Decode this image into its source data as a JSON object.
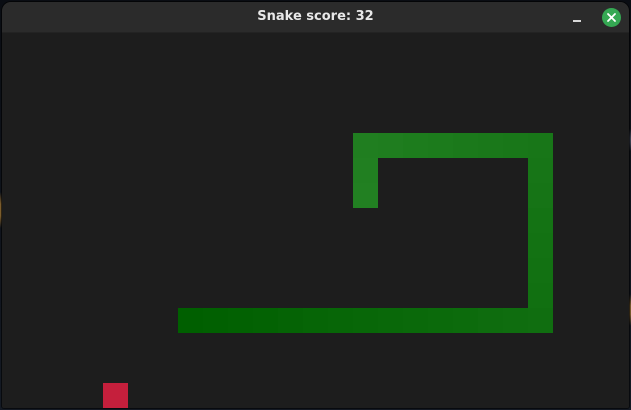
{
  "window": {
    "title": "Snake score: 32",
    "close_icon": "close-icon",
    "minimize_icon": "minimize-icon"
  },
  "game": {
    "score": 32,
    "grid_columns": 25,
    "grid_rows": 15,
    "snake_color_head": "#228022",
    "snake_color_tail": "#005f00",
    "food_color": "#c51f3c",
    "background_color": "#1d1d1d",
    "snake": [
      {
        "col": 14,
        "row": 6
      },
      {
        "col": 14,
        "row": 5
      },
      {
        "col": 14,
        "row": 4
      },
      {
        "col": 15,
        "row": 4
      },
      {
        "col": 16,
        "row": 4
      },
      {
        "col": 17,
        "row": 4
      },
      {
        "col": 18,
        "row": 4
      },
      {
        "col": 19,
        "row": 4
      },
      {
        "col": 20,
        "row": 4
      },
      {
        "col": 21,
        "row": 4
      },
      {
        "col": 21,
        "row": 5
      },
      {
        "col": 21,
        "row": 6
      },
      {
        "col": 21,
        "row": 7
      },
      {
        "col": 21,
        "row": 8
      },
      {
        "col": 21,
        "row": 9
      },
      {
        "col": 21,
        "row": 10
      },
      {
        "col": 21,
        "row": 11
      },
      {
        "col": 20,
        "row": 11
      },
      {
        "col": 19,
        "row": 11
      },
      {
        "col": 18,
        "row": 11
      },
      {
        "col": 17,
        "row": 11
      },
      {
        "col": 16,
        "row": 11
      },
      {
        "col": 15,
        "row": 11
      },
      {
        "col": 14,
        "row": 11
      },
      {
        "col": 13,
        "row": 11
      },
      {
        "col": 12,
        "row": 11
      },
      {
        "col": 11,
        "row": 11
      },
      {
        "col": 10,
        "row": 11
      },
      {
        "col": 9,
        "row": 11
      },
      {
        "col": 8,
        "row": 11
      },
      {
        "col": 7,
        "row": 11
      }
    ],
    "food": {
      "col": 4,
      "row": 14
    }
  }
}
